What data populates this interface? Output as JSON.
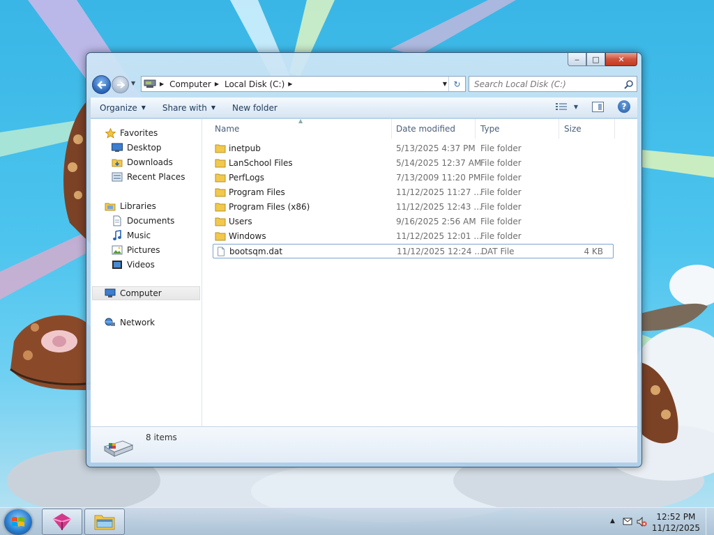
{
  "window": {
    "address_crumbs": [
      "Computer",
      "Local Disk (C:)"
    ],
    "search_placeholder": "Search Local Disk (C:)",
    "caption": {
      "minimize": "‒",
      "maximize": "□",
      "close": "✕"
    }
  },
  "command_bar": {
    "organize": "Organize",
    "share_with": "Share with",
    "new_folder": "New folder"
  },
  "nav_pane": {
    "favorites": "Favorites",
    "favorites_items": [
      "Desktop",
      "Downloads",
      "Recent Places"
    ],
    "libraries": "Libraries",
    "libraries_items": [
      "Documents",
      "Music",
      "Pictures",
      "Videos"
    ],
    "computer": "Computer",
    "network": "Network"
  },
  "columns": {
    "name": "Name",
    "date": "Date modified",
    "type": "Type",
    "size": "Size"
  },
  "files": [
    {
      "name": "inetpub",
      "date": "5/13/2025 4:37 PM",
      "type": "File folder",
      "size": ""
    },
    {
      "name": "LanSchool Files",
      "date": "5/14/2025 12:37 AM",
      "type": "File folder",
      "size": ""
    },
    {
      "name": "PerfLogs",
      "date": "7/13/2009 11:20 PM",
      "type": "File folder",
      "size": ""
    },
    {
      "name": "Program Files",
      "date": "11/12/2025 11:27 ...",
      "type": "File folder",
      "size": ""
    },
    {
      "name": "Program Files (x86)",
      "date": "11/12/2025 12:43 ...",
      "type": "File folder",
      "size": ""
    },
    {
      "name": "Users",
      "date": "9/16/2025 2:56 AM",
      "type": "File folder",
      "size": ""
    },
    {
      "name": "Windows",
      "date": "11/12/2025 12:01 ...",
      "type": "File folder",
      "size": ""
    },
    {
      "name": "bootsqm.dat",
      "date": "11/12/2025 12:24 ...",
      "type": "DAT File",
      "size": "4 KB"
    }
  ],
  "details": {
    "item_count": "8 items"
  },
  "taskbar": {
    "time": "12:52 PM",
    "date": "11/12/2025",
    "pinned": [
      "app-icon",
      "windows-explorer-icon"
    ]
  },
  "colors": {
    "accent": "#2a63b4",
    "folder": "#f2c94c",
    "close": "#c23a22"
  }
}
